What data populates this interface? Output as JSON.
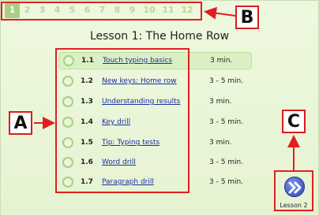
{
  "lessons": {
    "numbers": [
      "1",
      "2",
      "3",
      "4",
      "5",
      "6",
      "7",
      "8",
      "9",
      "10",
      "11",
      "12"
    ],
    "current": "1"
  },
  "page_title": "Lesson 1: The Home Row",
  "items": [
    {
      "num": "1.1",
      "title": "Touch typing basics",
      "time": "3 min."
    },
    {
      "num": "1.2",
      "title": "New keys: Home row ",
      "time": "3 - 5 min."
    },
    {
      "num": "1.3",
      "title": "Understanding results",
      "time": "3 min."
    },
    {
      "num": "1.4",
      "title": "Key drill",
      "time": "3 - 5 min."
    },
    {
      "num": "1.5",
      "title": "Tip: Typing tests",
      "time": "3 min."
    },
    {
      "num": "1.6",
      "title": "Word drill",
      "time": "3 - 5 min."
    },
    {
      "num": "1.7",
      "title": "Paragraph drill",
      "time": "3 - 5 min."
    }
  ],
  "callouts": {
    "a": "A",
    "b": "B",
    "c": "C"
  },
  "next_lesson_label": "Lesson 2",
  "colors": {
    "accent_green": "#a9cf82",
    "callout_red": "#e02020",
    "link_blue": "#1a2fa0"
  }
}
